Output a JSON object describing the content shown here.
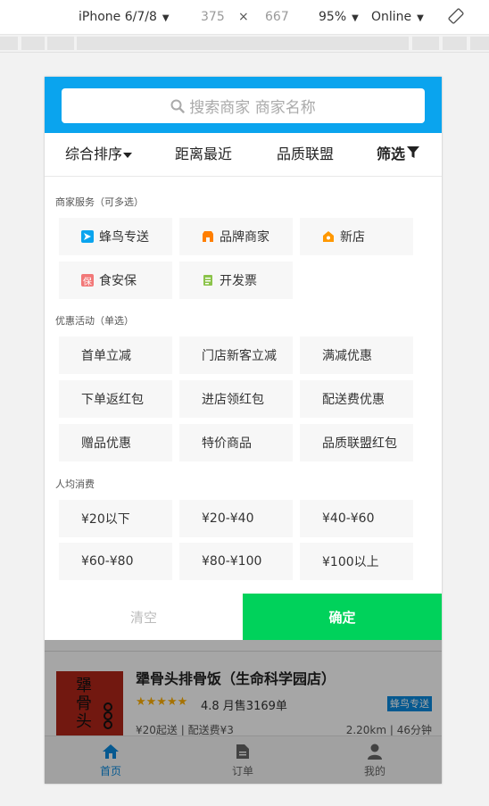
{
  "devtools": {
    "device": "iPhone 6/7/8",
    "width": "375",
    "times": "×",
    "height": "667",
    "zoom": "95%",
    "network": "Online",
    "caret": "▼"
  },
  "search": {
    "placeholder": "搜索商家 商家名称"
  },
  "sort": {
    "comprehensive": "综合排序",
    "nearest": "距离最近",
    "quality": "品质联盟",
    "filter": "筛选"
  },
  "filter": {
    "services": {
      "title": "商家服务（可多选）",
      "items": [
        {
          "label": "蜂鸟专送",
          "icon_color": "#0aa4ee",
          "icon": "bird-icon"
        },
        {
          "label": "品牌商家",
          "icon_color": "#ff7f00",
          "icon": "store-icon"
        },
        {
          "label": "新店",
          "icon_color": "#ff9800",
          "icon": "new-icon"
        },
        {
          "label": "食安保",
          "icon_color": "#f27878",
          "icon_text": "保",
          "icon": "shield-icon"
        },
        {
          "label": "开发票",
          "icon_color": "#8bc34a",
          "icon": "invoice-icon"
        }
      ]
    },
    "promotions": {
      "title": "优惠活动（单选）",
      "items": [
        "首单立减",
        "门店新客立减",
        "满减优惠",
        "下单返红包",
        "进店领红包",
        "配送费优惠",
        "赠品优惠",
        "特价商品",
        "品质联盟红包"
      ]
    },
    "price": {
      "title": "人均消费",
      "items": [
        "¥20以下",
        "¥20-¥40",
        "¥40-¥60",
        "¥60-¥80",
        "¥80-¥100",
        "¥100以上"
      ]
    },
    "clear": "清空",
    "confirm": "确定"
  },
  "shop": {
    "name": "犟骨头排骨饭（生命科学园店）",
    "stars": "★★★★★",
    "rating": "4.8 月售3169单",
    "badge": "蜂鸟专送",
    "min_delivery": "¥20起送 | 配送费¥3",
    "distance": "2.20km | 46分钟",
    "logo_text": "犟骨头"
  },
  "tabs": {
    "home": "首页",
    "orders": "订单",
    "mine": "我的"
  },
  "colors": {
    "brand_blue": "#0aa4ee",
    "confirm_green": "#00d25b"
  }
}
